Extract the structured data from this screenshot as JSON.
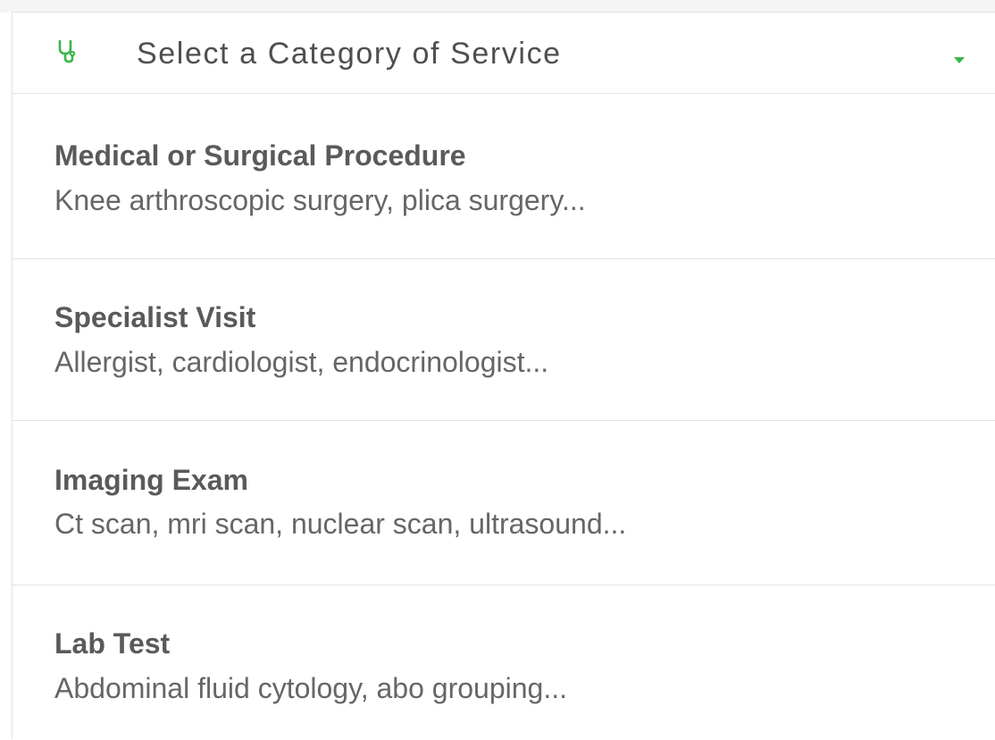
{
  "select": {
    "placeholder": "Select a Category of Service",
    "icon": "stethoscope-icon",
    "caret_icon": "caret-down-icon",
    "accent_color": "#3cb54a"
  },
  "options": [
    {
      "title": "Medical or Surgical Procedure",
      "description": "Knee arthroscopic surgery, plica surgery..."
    },
    {
      "title": "Specialist Visit",
      "description": "Allergist, cardiologist, endocrinologist..."
    },
    {
      "title": "Imaging Exam",
      "description": "Ct scan, mri scan, nuclear scan, ultrasound..."
    },
    {
      "title": "Lab Test",
      "description": "Abdominal fluid cytology, abo grouping..."
    }
  ]
}
